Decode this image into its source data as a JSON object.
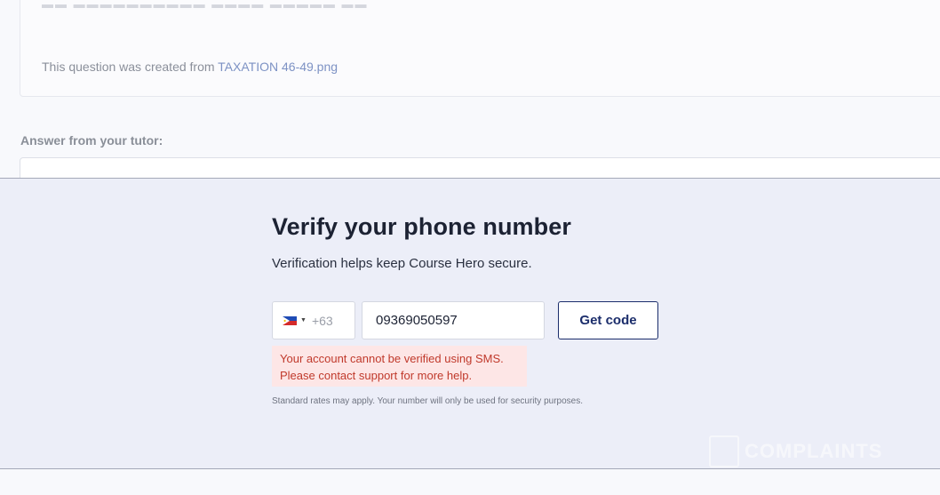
{
  "question": {
    "created_prefix": "This question was created from ",
    "file_name": "TAXATION 46-49.png"
  },
  "answer": {
    "label": "Answer from your tutor:"
  },
  "verify": {
    "title": "Verify your phone number",
    "subtitle": "Verification helps keep Course Hero secure.",
    "country_flag": "philippines-flag-icon",
    "dial_code": "+63",
    "phone_value": "09369050597",
    "get_code_label": "Get code",
    "error_line1": "Your account cannot be verified using SMS.",
    "error_line2": "Please contact support for more help.",
    "disclaimer": "Standard rates may apply. Your number will only be used for security purposes."
  },
  "watermark": {
    "text": "COMPLAINTS"
  },
  "colors": {
    "panel_bg": "#eceef8",
    "accent": "#1b2d6b",
    "error_text": "#c0392b",
    "error_bg": "#fde6e6",
    "link": "#7d92c4"
  }
}
